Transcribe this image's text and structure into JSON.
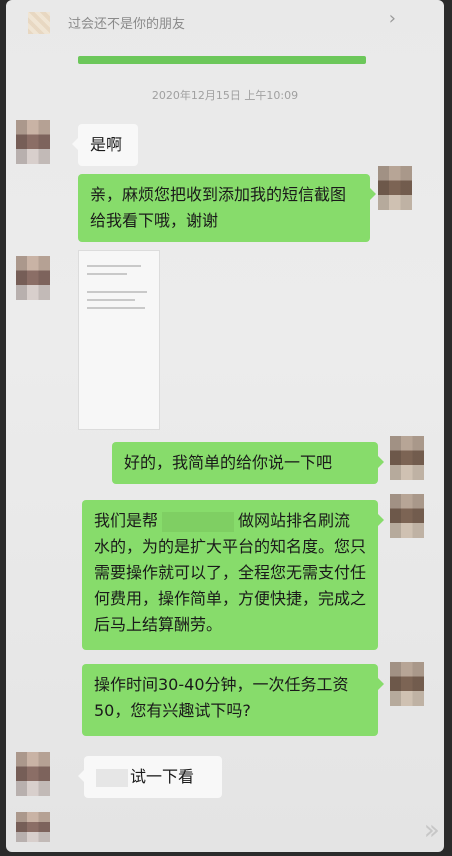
{
  "header": {
    "title": "过会还不是你的朋友"
  },
  "timestamp": "2020年12月15日 上午10:09",
  "messages": [
    {
      "side": "left",
      "type": "text",
      "text": "是啊"
    },
    {
      "side": "right",
      "type": "text",
      "text": "亲，麻烦您把收到添加我的短信截图给我看下哦，谢谢"
    },
    {
      "side": "left",
      "type": "image"
    },
    {
      "side": "right",
      "type": "text",
      "text": "好的，我简单的给你说一下吧"
    },
    {
      "side": "right",
      "type": "text",
      "text_before": "我们是帮",
      "text_after": "做网站排名刷流水的，为的是扩大平台的知名度。您只需要操作就可以了，全程您无需支付任何费用，操作简单，方便快捷，完成之后马上结算酬劳。"
    },
    {
      "side": "right",
      "type": "text",
      "text": "操作时间30-40分钟，一次任务工资50，您有兴趣试下吗?"
    },
    {
      "side": "left",
      "type": "text",
      "text": "试一下看"
    }
  ],
  "icons": {
    "chevron": "chevron-right-icon",
    "watermark": "double-chevron-icon"
  }
}
